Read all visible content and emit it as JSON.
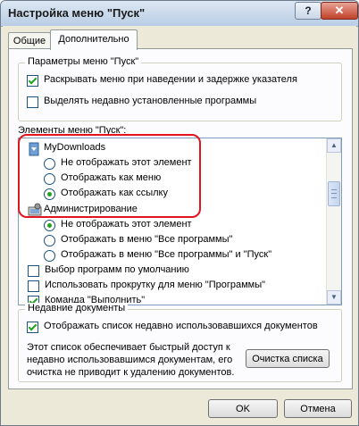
{
  "window": {
    "title": "Настройка меню \"Пуск\"",
    "help": "?",
    "close": "✕"
  },
  "tabs": [
    {
      "label": "Общие"
    },
    {
      "label": "Дополнительно"
    }
  ],
  "start_menu_params": {
    "legend": "Параметры меню \"Пуск\"",
    "items": [
      {
        "label": "Раскрывать меню при наведении и задержке указателя",
        "checked": true
      },
      {
        "label": "Выделять недавно установленные программы",
        "checked": false
      }
    ]
  },
  "start_menu_items": {
    "caption": "Элементы меню \"Пуск\":",
    "mydownloads": {
      "label": "MyDownloads",
      "options": [
        {
          "label": "Не отображать этот элемент",
          "selected": false
        },
        {
          "label": "Отображать как меню",
          "selected": false
        },
        {
          "label": "Отображать как ссылку",
          "selected": true
        }
      ]
    },
    "admin": {
      "label": "Администрирование",
      "options": [
        {
          "label": "Не отображать этот элемент",
          "selected": true
        },
        {
          "label": "Отображать в меню \"Все программы\"",
          "selected": false
        },
        {
          "label": "Отображать в меню \"Все программы\" и \"Пуск\"",
          "selected": false
        }
      ]
    },
    "checkboxes": [
      {
        "label": "Выбор программ по умолчанию",
        "checked": false
      },
      {
        "label": "Использовать прокрутку для меню \"Программы\"",
        "checked": false
      },
      {
        "label": "Команда \"Выполнить\"",
        "checked": true
      }
    ]
  },
  "recent_docs": {
    "legend": "Недавние документы",
    "checkbox_label": "Отображать список недавно использовавшихся документов",
    "checked": true,
    "note": "Этот список обеспечивает быстрый доступ к недавно использовавшимся документам, его очистка не приводит к удалению документов.",
    "clear_button": "Очистка списка"
  },
  "buttons": {
    "ok": "OK",
    "cancel": "Отмена"
  },
  "colors": {
    "highlight": "#e2141e",
    "check": "#21a121"
  }
}
